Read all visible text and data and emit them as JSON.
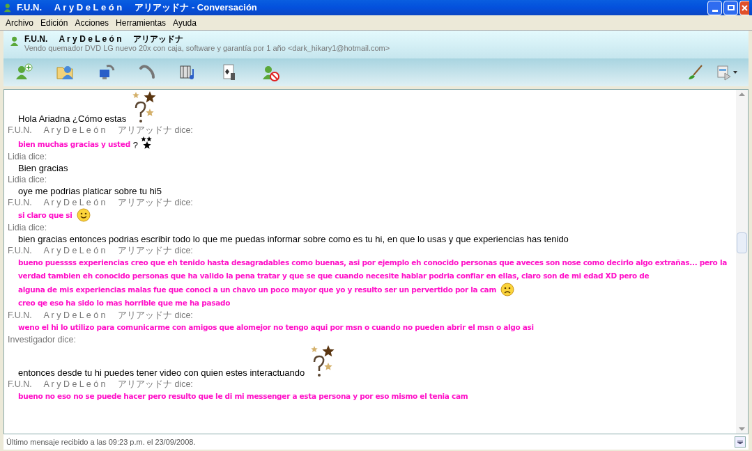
{
  "window": {
    "title": "F.U.N.     A r y D e L e ó n     アリアッドナ - Conversación"
  },
  "menu": [
    "Archivo",
    "Edición",
    "Acciones",
    "Herramientas",
    "Ayuda"
  ],
  "contact": {
    "name": "F.U.N.     A r y D e L e ó n     アリアッドナ",
    "status": "Vendo quemador DVD LG nuevo 20x con caja, software y garantía por 1 año <dark_hikary1@hotmail.com>"
  },
  "conversation": [
    {
      "kind": "message",
      "parts": [
        {
          "kind": "text",
          "text": "Hola Ariadna ¿Cómo estas"
        },
        {
          "kind": "question-stars"
        }
      ]
    },
    {
      "kind": "sender",
      "text": "F.U.N.     A r y D e L e ó n     アリアッドナ dice:"
    },
    {
      "kind": "fun-message",
      "parts": [
        {
          "kind": "text",
          "text": "bien muchas gracias y usted"
        },
        {
          "kind": "plain-text",
          "text": "?"
        },
        {
          "kind": "small-stars"
        }
      ]
    },
    {
      "kind": "sender",
      "text": "Lidia dice:"
    },
    {
      "kind": "message",
      "parts": [
        {
          "kind": "text",
          "text": "Bien gracias"
        }
      ]
    },
    {
      "kind": "sender",
      "text": "Lidia dice:"
    },
    {
      "kind": "message",
      "parts": [
        {
          "kind": "text",
          "text": "oye me podrias platicar sobre tu hi5"
        }
      ]
    },
    {
      "kind": "sender",
      "text": "F.U.N.     A r y D e L e ó n     アリアッドナ dice:"
    },
    {
      "kind": "fun-message",
      "parts": [
        {
          "kind": "text",
          "text": "si claro que si"
        },
        {
          "kind": "smile"
        }
      ]
    },
    {
      "kind": "sender",
      "text": "Lidia dice:"
    },
    {
      "kind": "message",
      "parts": [
        {
          "kind": "text",
          "text": "bien gracias entonces podrias escribir todo lo que me puedas informar sobre como es tu hi, en que lo usas y que experiencias has tenido"
        }
      ]
    },
    {
      "kind": "sender",
      "text": "F.U.N.     A r y D e L e ó n     アリアッドナ dice:"
    },
    {
      "kind": "fun-message",
      "parts": [
        {
          "kind": "text",
          "text": "bueno puessss experiencias creo que eh tenido hasta desagradables como buenas, asi por ejemplo eh conocido personas que aveces son nose como decirlo algo extrañas... pero la verdad tambien eh conocido personas que ha valido la pena tratar y que se que cuando necesite hablar podria confiar en ellas, claro son de mi edad XD pero de"
        }
      ]
    },
    {
      "kind": "fun-message",
      "parts": [
        {
          "kind": "text",
          "text": "alguna de mis experiencias malas fue que conoci a un chavo un poco mayor que yo y resulto ser un pervertido por la cam"
        },
        {
          "kind": "sad"
        },
        {
          "kind": "text",
          "text": "creo qe eso ha sido lo mas horrible que me ha pasado"
        }
      ]
    },
    {
      "kind": "sender",
      "text": "F.U.N.     A r y D e L e ó n     アリアッドナ dice:"
    },
    {
      "kind": "fun-message",
      "parts": [
        {
          "kind": "text",
          "text": "weno el hi lo utilizo para comunicarme con amigos que alomejor no tengo aqui por msn o cuando no pueden abrir el msn o algo asi"
        }
      ]
    },
    {
      "kind": "sender",
      "text": "Investigador dice:"
    },
    {
      "kind": "message",
      "parts": [
        {
          "kind": "text",
          "text": "entonces desde tu hi puedes tener video con quien estes interactuando"
        },
        {
          "kind": "question-stars"
        }
      ]
    },
    {
      "kind": "sender",
      "text": "F.U.N.     A r y D e L e ó n     アリアッドナ dice:"
    },
    {
      "kind": "fun-message",
      "parts": [
        {
          "kind": "text",
          "text": "bueno no eso no se puede hacer pero resulto que le di mi messenger a esta persona y por eso mismo el tenia cam"
        }
      ]
    }
  ],
  "status_bar": "Último mensaje recibido a las 09:23 p.m. el 23/09/2008."
}
